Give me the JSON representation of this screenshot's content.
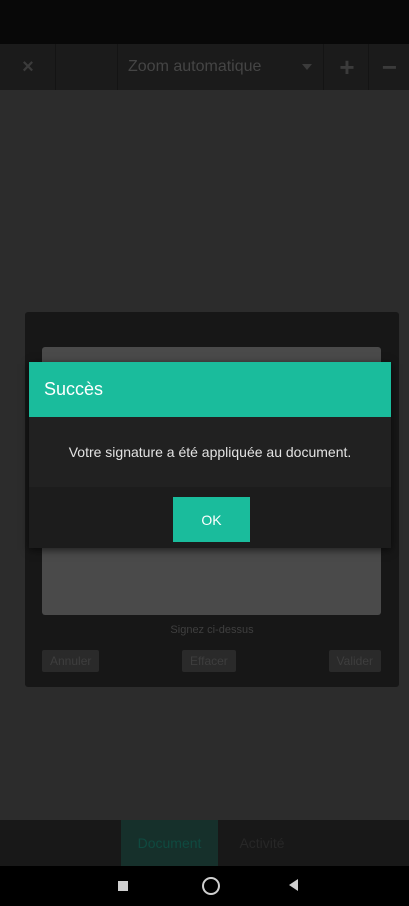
{
  "toolbar": {
    "close_icon": "×",
    "zoom_value": "Zoom automatique",
    "zoom_in_icon": "+",
    "zoom_out_icon": "−"
  },
  "signature_dialog": {
    "hint": "Signez ci-dessus",
    "cancel_label": "Annuler",
    "clear_label": "Effacer",
    "validate_label": "Valider"
  },
  "success_dialog": {
    "title": "Succès",
    "message": "Votre signature a été appliquée au document.",
    "ok_label": "OK",
    "accent_color": "#1abc9c"
  },
  "tabs": [
    {
      "label": "Document",
      "active": true
    },
    {
      "label": "Activité",
      "active": false
    }
  ],
  "nav_bar": {
    "recent_icon": "square-icon",
    "home_icon": "circle-icon",
    "back_icon": "triangle-back-icon"
  }
}
